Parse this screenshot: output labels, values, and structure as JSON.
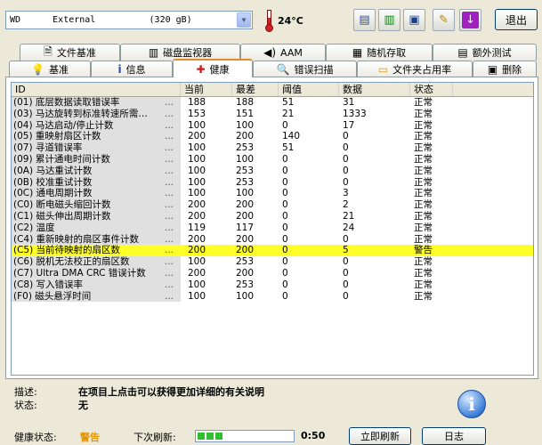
{
  "toolbar": {
    "drive_label": "WD      External          (320 gB)",
    "temperature": "24°C",
    "exit_label": "退出"
  },
  "tabs_top": [
    {
      "label": "文件基准",
      "icon": "document-icon"
    },
    {
      "label": "磁盘监视器",
      "icon": "chart-icon"
    },
    {
      "label": "AAM",
      "icon": "speaker-icon"
    },
    {
      "label": "随机存取",
      "icon": "random-access-icon"
    },
    {
      "label": "额外测试",
      "icon": "extra-tests-icon"
    }
  ],
  "tabs_bottom": [
    {
      "label": "基准",
      "icon": "bulb-icon"
    },
    {
      "label": "信息",
      "icon": "info-icon"
    },
    {
      "label": "健康",
      "icon": "health-cross-icon",
      "active": true
    },
    {
      "label": "错误扫描",
      "icon": "magnifier-icon"
    },
    {
      "label": "文件夹占用率",
      "icon": "folder-icon"
    },
    {
      "label": "删除",
      "icon": "delete-icon"
    }
  ],
  "table": {
    "headers": [
      "ID",
      "当前",
      "最差",
      "阈值",
      "数据",
      "状态"
    ],
    "rows": [
      {
        "id": "(01) 底层数据读取错误率",
        "cur": "188",
        "worst": "188",
        "thr": "51",
        "data": "31",
        "status": "正常"
      },
      {
        "id": "(03) 马达旋转到标准转速所需…",
        "cur": "153",
        "worst": "151",
        "thr": "21",
        "data": "1333",
        "status": "正常"
      },
      {
        "id": "(04) 马达启动/停止计数",
        "cur": "100",
        "worst": "100",
        "thr": "0",
        "data": "17",
        "status": "正常"
      },
      {
        "id": "(05) 重映射扇区计数",
        "cur": "200",
        "worst": "200",
        "thr": "140",
        "data": "0",
        "status": "正常"
      },
      {
        "id": "(07) 寻道错误率",
        "cur": "100",
        "worst": "253",
        "thr": "51",
        "data": "0",
        "status": "正常"
      },
      {
        "id": "(09) 累计通电时间计数",
        "cur": "100",
        "worst": "100",
        "thr": "0",
        "data": "0",
        "status": "正常"
      },
      {
        "id": "(0A) 马达重试计数",
        "cur": "100",
        "worst": "253",
        "thr": "0",
        "data": "0",
        "status": "正常"
      },
      {
        "id": "(0B) 校准重试计数",
        "cur": "100",
        "worst": "253",
        "thr": "0",
        "data": "0",
        "status": "正常"
      },
      {
        "id": "(0C) 通电周期计数",
        "cur": "100",
        "worst": "100",
        "thr": "0",
        "data": "3",
        "status": "正常"
      },
      {
        "id": "(C0) 断电磁头缩回计数",
        "cur": "200",
        "worst": "200",
        "thr": "0",
        "data": "2",
        "status": "正常"
      },
      {
        "id": "(C1) 磁头伸出周期计数",
        "cur": "200",
        "worst": "200",
        "thr": "0",
        "data": "21",
        "status": "正常"
      },
      {
        "id": "(C2) 温度",
        "cur": "119",
        "worst": "117",
        "thr": "0",
        "data": "24",
        "status": "正常"
      },
      {
        "id": "(C4) 重新映射的扇区事件计数",
        "cur": "200",
        "worst": "200",
        "thr": "0",
        "data": "0",
        "status": "正常"
      },
      {
        "id": "(C5) 当前待映射的扇区数",
        "cur": "200",
        "worst": "200",
        "thr": "0",
        "data": "5",
        "status": "警告",
        "highlight": true
      },
      {
        "id": "(C6) 脱机无法校正的扇区数",
        "cur": "100",
        "worst": "253",
        "thr": "0",
        "data": "0",
        "status": "正常"
      },
      {
        "id": "(C7) Ultra DMA CRC 错误计数",
        "cur": "200",
        "worst": "200",
        "thr": "0",
        "data": "0",
        "status": "正常"
      },
      {
        "id": "(C8) 写入错误率",
        "cur": "100",
        "worst": "253",
        "thr": "0",
        "data": "0",
        "status": "正常"
      },
      {
        "id": "(F0) 磁头悬浮时间",
        "cur": "100",
        "worst": "100",
        "thr": "0",
        "data": "0",
        "status": "正常"
      }
    ]
  },
  "description": {
    "desc_label": "描述:",
    "desc_text": "在项目上点击可以获得更加详细的有关说明",
    "state_label": "状态:",
    "state_text": "无"
  },
  "statusbar": {
    "health_label": "健康状态:",
    "health_value": "警告",
    "refresh_label": "下次刷新:",
    "refresh_progress": 0.3,
    "refresh_time": "0:50",
    "refresh_now_label": "立即刷新",
    "log_label": "日志"
  },
  "colors": {
    "highlight": "#ffff2a",
    "warning_text": "#e69500",
    "active_tab_accent": "#e68b2c"
  }
}
